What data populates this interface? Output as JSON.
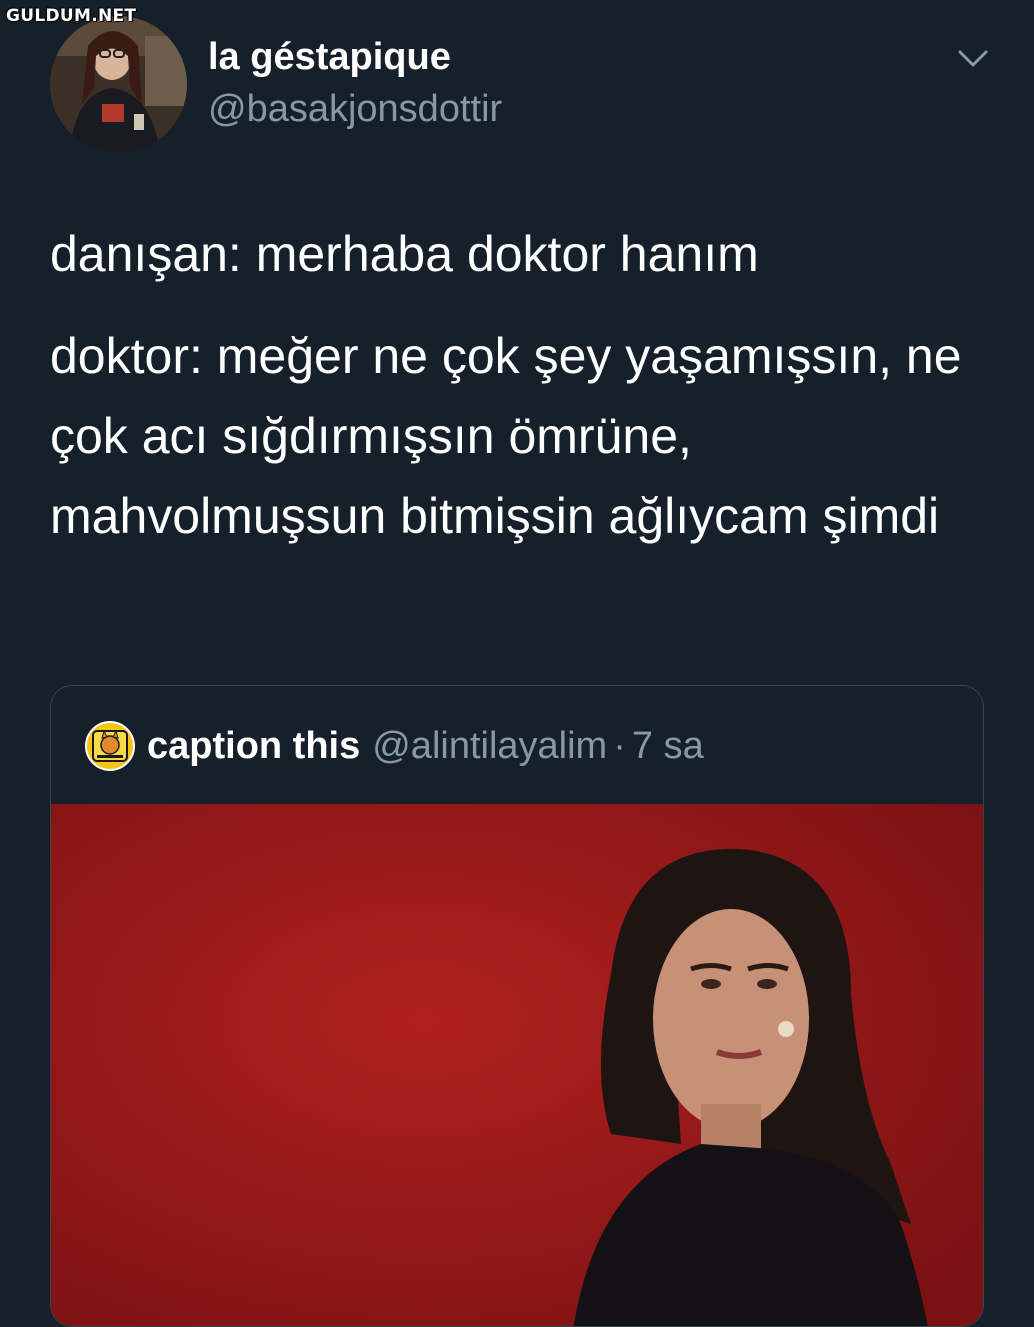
{
  "watermark": "GULDUM.NET",
  "tweet": {
    "author_name": "la géstapique",
    "author_handle": "@basakjonsdottir",
    "text_line1": "danışan: merhaba doktor hanım",
    "text_line2": "doktor: meğer ne çok şey yaşamışsın, ne çok acı sığdırmışsın ömrüne, mahvolmuşsun bitmişsin ağlıycam şimdi",
    "menu_icon": "chevron-down-icon"
  },
  "quoted_tweet": {
    "author_name": "caption this",
    "author_handle": "@alintilayalim",
    "separator": "·",
    "time": "7 sa",
    "media_background": "#a01a1d"
  },
  "colors": {
    "background": "#15202b",
    "secondary_text": "#8899a6",
    "border": "#38444d"
  }
}
